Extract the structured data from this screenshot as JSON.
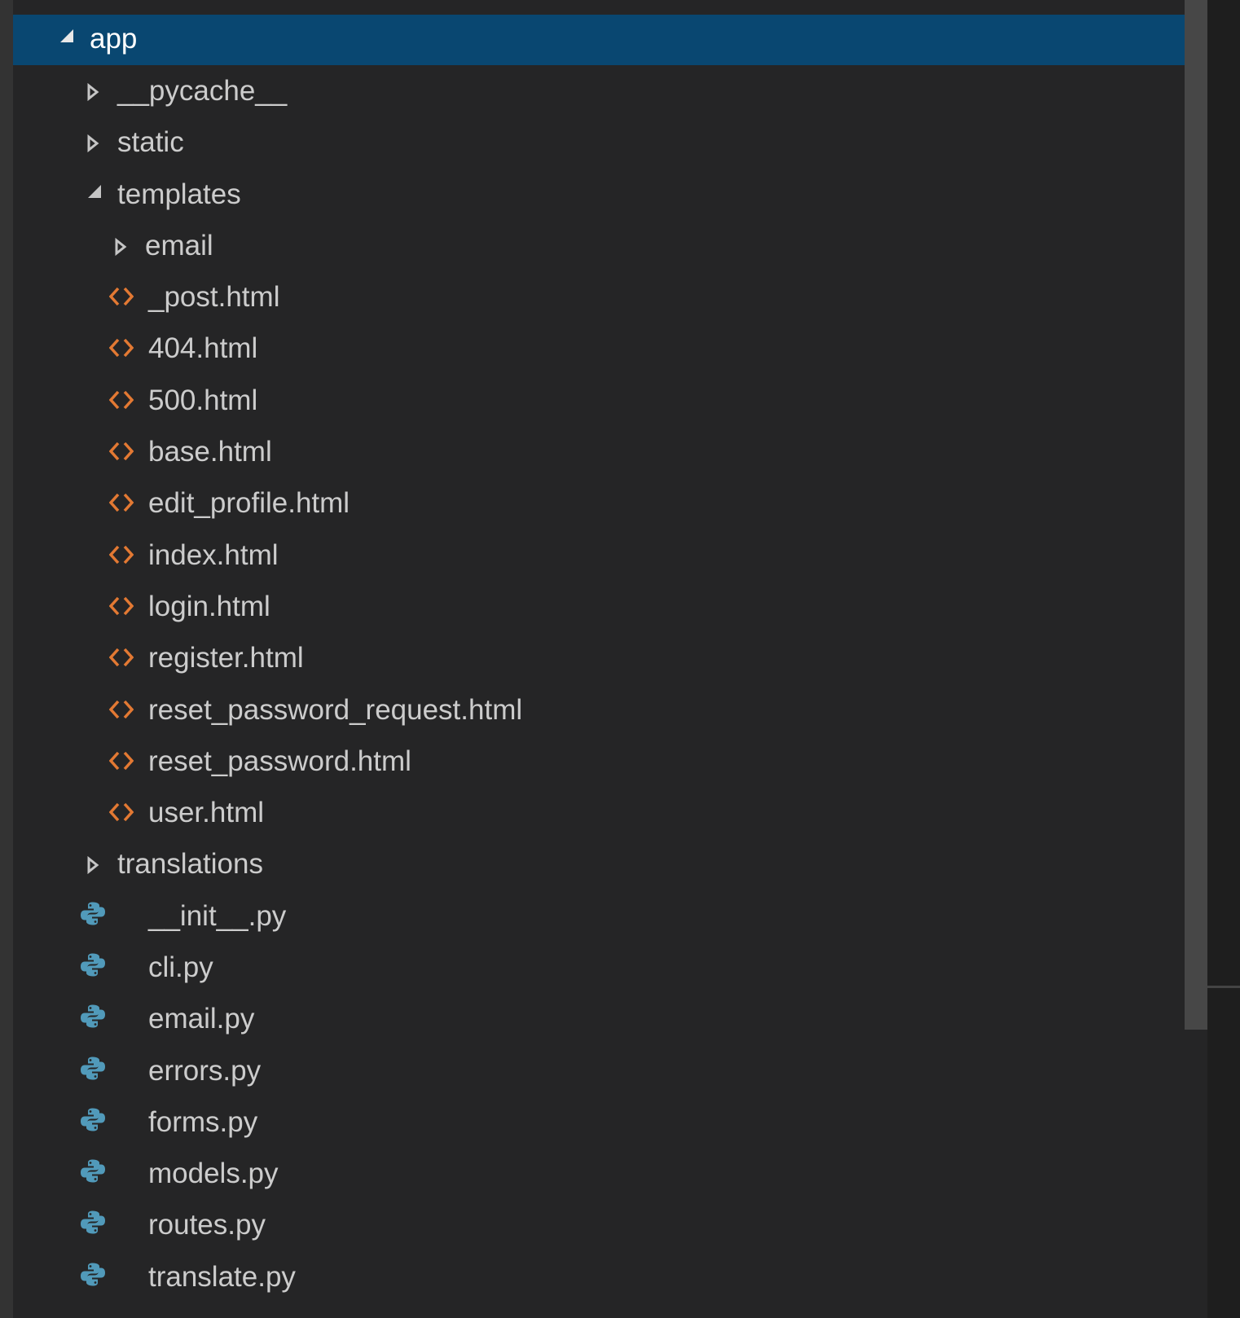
{
  "colors": {
    "selection": "#094771",
    "text": "#cccccc",
    "html_icon": "#e37933",
    "python_icon": "#519aba"
  },
  "tree": [
    {
      "label": "app",
      "level": 0,
      "type": "folder",
      "expanded": true,
      "selected": true
    },
    {
      "label": "__pycache__",
      "level": 1,
      "type": "folder",
      "expanded": false
    },
    {
      "label": "static",
      "level": 1,
      "type": "folder",
      "expanded": false
    },
    {
      "label": "templates",
      "level": 1,
      "type": "folder",
      "expanded": true
    },
    {
      "label": "email",
      "level": 2,
      "type": "folder",
      "expanded": false
    },
    {
      "label": "_post.html",
      "level": 2,
      "type": "html"
    },
    {
      "label": "404.html",
      "level": 2,
      "type": "html"
    },
    {
      "label": "500.html",
      "level": 2,
      "type": "html"
    },
    {
      "label": "base.html",
      "level": 2,
      "type": "html"
    },
    {
      "label": "edit_profile.html",
      "level": 2,
      "type": "html"
    },
    {
      "label": "index.html",
      "level": 2,
      "type": "html"
    },
    {
      "label": "login.html",
      "level": 2,
      "type": "html"
    },
    {
      "label": "register.html",
      "level": 2,
      "type": "html"
    },
    {
      "label": "reset_password_request.html",
      "level": 2,
      "type": "html"
    },
    {
      "label": "reset_password.html",
      "level": 2,
      "type": "html"
    },
    {
      "label": "user.html",
      "level": 2,
      "type": "html"
    },
    {
      "label": "translations",
      "level": 1,
      "type": "folder",
      "expanded": false
    },
    {
      "label": "__init__.py",
      "level": 1,
      "type": "python"
    },
    {
      "label": "cli.py",
      "level": 1,
      "type": "python"
    },
    {
      "label": "email.py",
      "level": 1,
      "type": "python"
    },
    {
      "label": "errors.py",
      "level": 1,
      "type": "python"
    },
    {
      "label": "forms.py",
      "level": 1,
      "type": "python"
    },
    {
      "label": "models.py",
      "level": 1,
      "type": "python"
    },
    {
      "label": "routes.py",
      "level": 1,
      "type": "python"
    },
    {
      "label": "translate.py",
      "level": 1,
      "type": "python"
    }
  ]
}
